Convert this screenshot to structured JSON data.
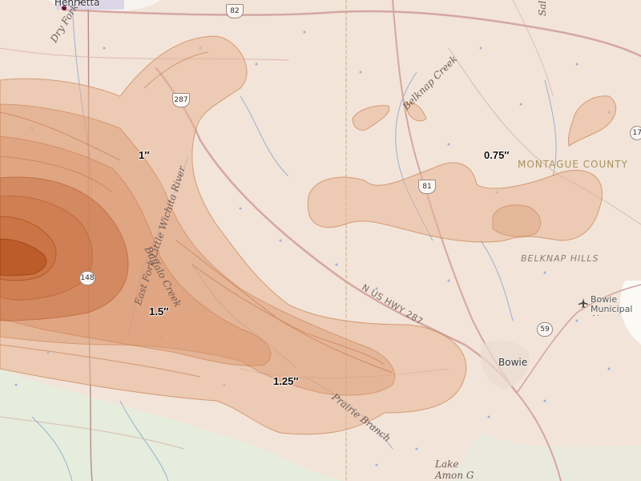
{
  "map": {
    "contour_labels": {
      "c_1": "1″",
      "c_075": "0.75″",
      "c_15": "1.5″",
      "c_125": "1.25″"
    },
    "places": {
      "henrietta": "Henrietta",
      "bowie": "Bowie",
      "bowie_airport": "Bowie Municipal Airport"
    },
    "area_labels": {
      "county": "MONTAGUE COUNTY",
      "region": "BELKNAP HILLS"
    },
    "water_labels": {
      "dry_fork": "Dry Fork Little Wichita",
      "belknap_creek": "Belknap Creek",
      "east_fork": "East Fork Little Wichita River",
      "buffalo_creek": "Buffalo Creek",
      "prairie_branch": "Prairie Branch",
      "lake_amon": "Lake Amon G",
      "sal": "Sal"
    },
    "roads": {
      "us287_label": "N US HWY 287"
    },
    "shields": {
      "s82": "82",
      "s287": "287",
      "s81": "81",
      "s148": "148",
      "s59": "59",
      "s17": "17"
    },
    "colors": {
      "base": "#f2e4d8",
      "precip_light": "#e8b597",
      "precip_mid": "#d98e63",
      "precip_dark": "#c66a38",
      "precip_core": "#b24f1c",
      "contour_stroke": "#c2753f",
      "water": "#7f9ec9",
      "road": "#d5a7a2",
      "green_land": "#e6eddc"
    },
    "icons": {
      "airport": "airport-icon"
    }
  }
}
